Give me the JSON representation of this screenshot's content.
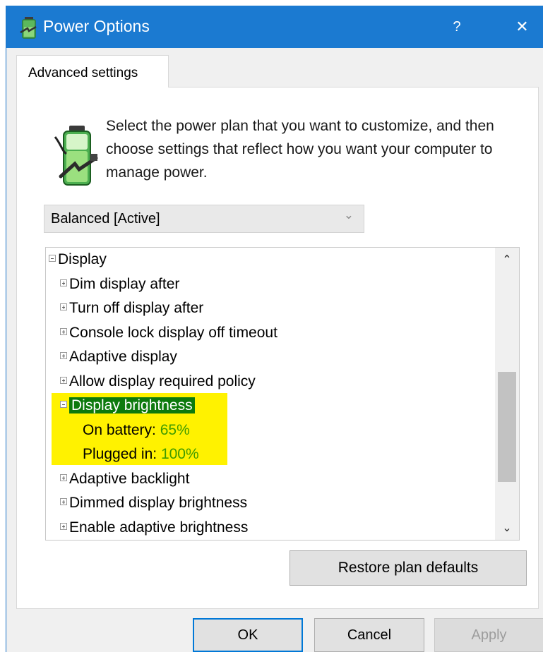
{
  "window": {
    "title": "Power Options",
    "help_label": "?",
    "close_label": "✕",
    "accent_color": "#1b7ad1"
  },
  "tab": {
    "label": "Advanced settings"
  },
  "description": "Select the power plan that you want to customize, and then choose settings that reflect how you want your computer to manage power.",
  "plan_select": {
    "value": "Balanced [Active]",
    "chevron": "⌄"
  },
  "tree": {
    "group": "Display",
    "items_before": [
      "Dim display after",
      "Turn off display after",
      "Console lock display off timeout",
      "Adaptive display",
      "Allow display required policy"
    ],
    "selected_item": "Display brightness",
    "selected_children": [
      {
        "label": "On battery:",
        "value": "65%"
      },
      {
        "label": "Plugged in:",
        "value": "100%"
      }
    ],
    "items_after": [
      "Adaptive backlight",
      "Dimmed display brightness",
      "Enable adaptive brightness"
    ],
    "highlight_color": "#fff200",
    "selection_color": "#0d7a0d"
  },
  "scrollbar": {
    "up": "⌃",
    "down": "⌄"
  },
  "buttons": {
    "restore": "Restore plan defaults",
    "ok": "OK",
    "cancel": "Cancel",
    "apply": "Apply"
  },
  "icons": {
    "app": "power-options-icon",
    "battery": "battery-plug-icon"
  }
}
